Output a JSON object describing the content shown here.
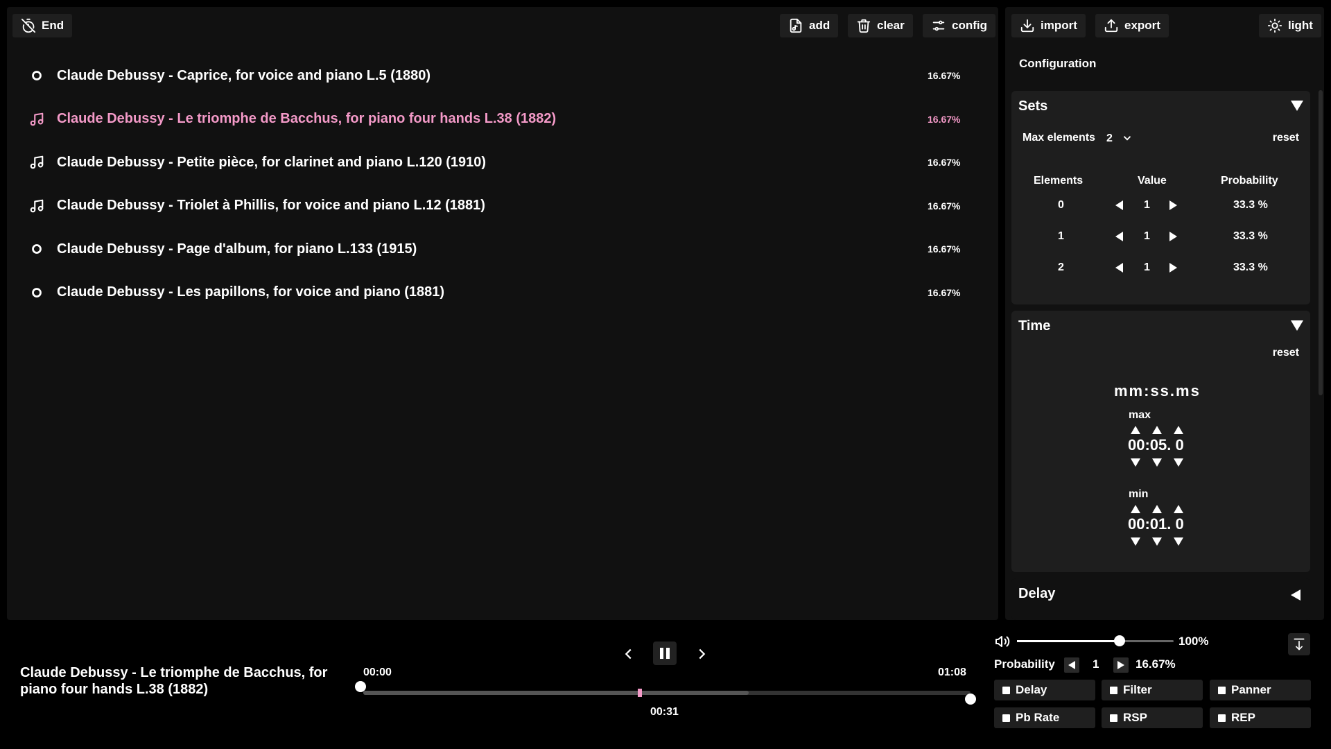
{
  "toolbar": {
    "end_label": "End",
    "add_label": "add",
    "clear_label": "clear",
    "config_label": "config",
    "import_label": "import",
    "export_label": "export",
    "theme_label": "light"
  },
  "tracks": [
    {
      "title": "Claude Debussy - Caprice, for voice and piano L.5 (1880)",
      "probability": "16.67%",
      "icon": "circle-icon",
      "active": false
    },
    {
      "title": "Claude Debussy - Le triomphe de Bacchus, for piano four hands L.38 (1882)",
      "probability": "16.67%",
      "icon": "music-note-icon",
      "active": true
    },
    {
      "title": "Claude Debussy - Petite pièce, for clarinet and piano L.120 (1910)",
      "probability": "16.67%",
      "icon": "music-note-icon",
      "active": false
    },
    {
      "title": "Claude Debussy - Triolet à Phillis, for voice and piano L.12 (1881)",
      "probability": "16.67%",
      "icon": "music-note-icon",
      "active": false
    },
    {
      "title": "Claude Debussy - Page d'album, for piano L.133 (1915)",
      "probability": "16.67%",
      "icon": "circle-icon",
      "active": false
    },
    {
      "title": "Claude Debussy - Les papillons, for voice and piano (1881)",
      "probability": "16.67%",
      "icon": "circle-icon",
      "active": false
    }
  ],
  "config": {
    "title": "Configuration",
    "sets": {
      "heading": "Sets",
      "max_elements_label": "Max elements",
      "max_elements_value": "2",
      "reset_label": "reset",
      "columns": [
        "Elements",
        "Value",
        "Probability"
      ],
      "rows": [
        {
          "element": "0",
          "value": "1",
          "probability": "33.3 %"
        },
        {
          "element": "1",
          "value": "1",
          "probability": "33.3 %"
        },
        {
          "element": "2",
          "value": "1",
          "probability": "33.3 %"
        }
      ]
    },
    "time": {
      "heading": "Time",
      "reset_label": "reset",
      "format_label": "mm:ss.ms",
      "max_label": "max",
      "max_value": "00:05. 0",
      "min_label": "min",
      "min_value": "00:01. 0"
    },
    "delay": {
      "heading": "Delay"
    }
  },
  "player": {
    "now_playing": "Claude Debussy - Le triomphe de Bacchus, for piano four hands L.38 (1882)",
    "time_start": "00:00",
    "time_end": "01:08",
    "time_current": "00:31",
    "progress_fraction": 0.4559,
    "buffer_fraction": 0.635,
    "volume_label": "100%",
    "volume_fraction": 1.0,
    "probability_label": "Probability",
    "probability_value": "1",
    "probability_percent": "16.67%",
    "effects": [
      "Delay",
      "Filter",
      "Panner",
      "Pb Rate",
      "RSP",
      "REP"
    ]
  },
  "colors": {
    "accent": "#f49ac8",
    "background": "#000000",
    "panel": "#111111",
    "section": "#1e1e1e"
  }
}
